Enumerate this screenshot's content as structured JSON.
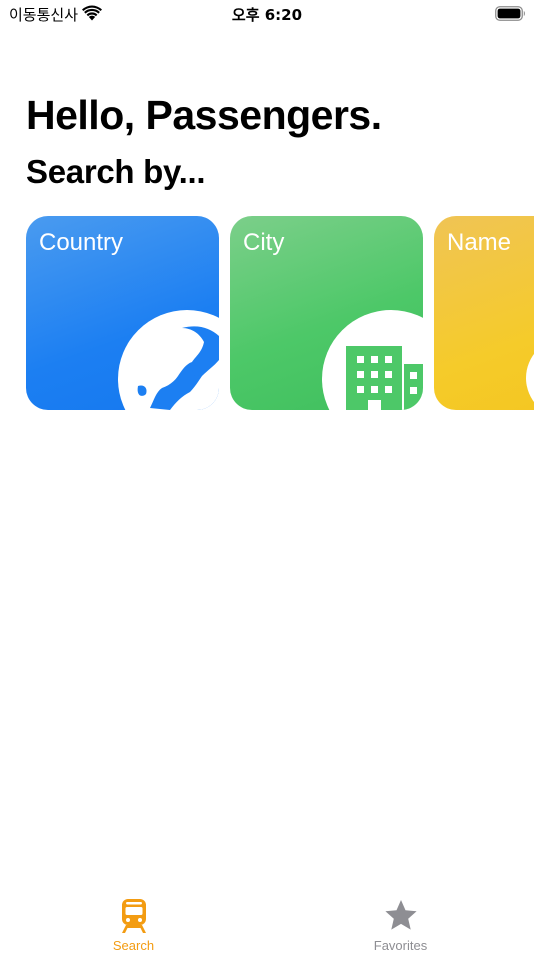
{
  "status_bar": {
    "carrier": "이동통신사",
    "time": "오후 6:20"
  },
  "header": {
    "greeting": "Hello, Passengers.",
    "subtitle": "Search by..."
  },
  "cards": [
    {
      "label": "Country",
      "icon": "globe-icon",
      "color": "#1C7FF2"
    },
    {
      "label": "City",
      "icon": "building-icon",
      "color": "#4DC868"
    },
    {
      "label": "Name",
      "icon": "person-icon",
      "color": "#F5CB2A"
    }
  ],
  "tab_bar": {
    "active_color": "#F39C12",
    "inactive_color": "#8E8E93",
    "items": [
      {
        "label": "Search",
        "icon": "train-icon",
        "selected": true
      },
      {
        "label": "Favorites",
        "icon": "star-icon",
        "selected": false
      }
    ]
  }
}
